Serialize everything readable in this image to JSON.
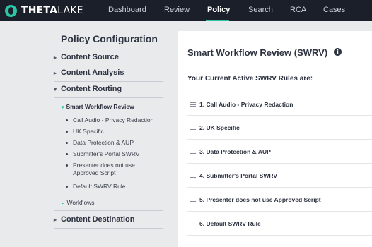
{
  "app": {
    "logo_bold": "THETA",
    "logo_light": "LAKE"
  },
  "nav": {
    "items": [
      "Dashboard",
      "Review",
      "Policy",
      "Search",
      "RCA",
      "Cases"
    ],
    "active": "Policy"
  },
  "sidebar": {
    "title": "Policy Configuration",
    "sections": [
      "Content Source",
      "Content Analysis",
      "Content Routing",
      "Content Destination"
    ],
    "sub_heading": "Smart Workflow Review",
    "rules": [
      "Call Audio - Privacy Redaction",
      "UK Specific",
      "Data Protection & AUP",
      "Submitter's Portal SWRV",
      "Presenter does not use Approved Script",
      "Default SWRV Rule"
    ],
    "workflows": "Workflows"
  },
  "main": {
    "title": "Smart Workflow Review (SWRV)",
    "subtitle": "Your Current Active SWRV Rules are:",
    "rules": [
      "1. Call Audio - Privacy Redaction",
      "2. UK Specific",
      "3. Data Protection & AUP",
      "4. Submitter's Portal SWRV",
      "5. Presenter does not use Approved Script",
      "6. Default SWRV Rule"
    ]
  },
  "colors": {
    "accent": "#2ec4a6",
    "topbar": "#1b1f2a",
    "page_bg": "#e9eaec"
  }
}
